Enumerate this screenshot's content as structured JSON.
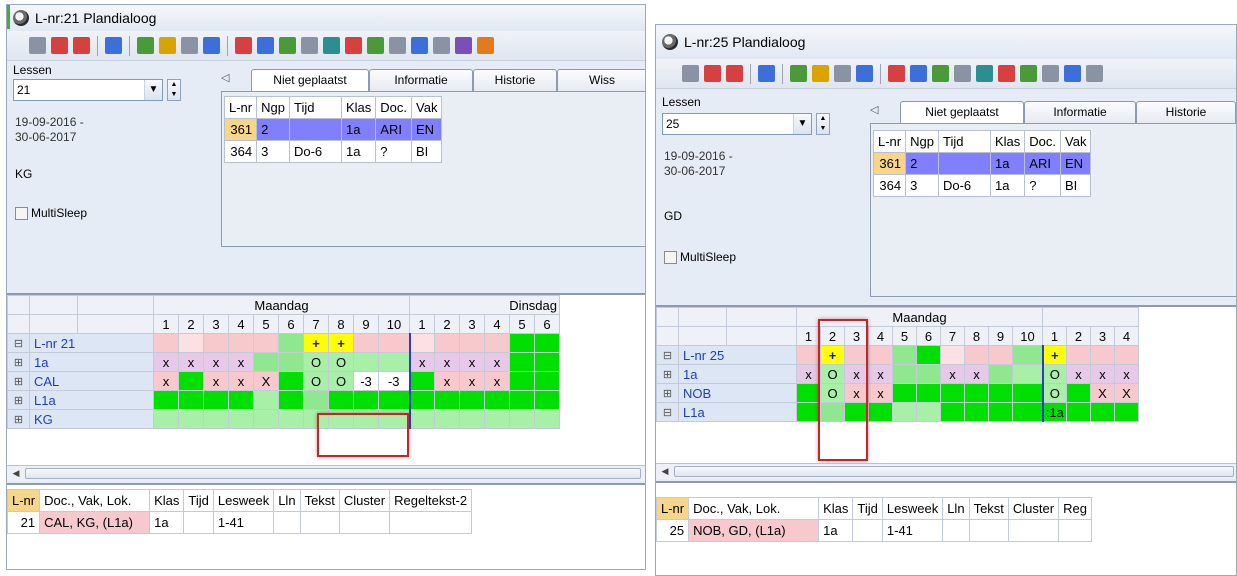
{
  "win1": {
    "title": "L-nr:21  Plandialoog",
    "lessons_label": "Lessen",
    "lesson_value": "21",
    "date_from": "19-09-2016 -",
    "date_to": "30-06-2017",
    "user_code": "KG",
    "multisleep": "MultiSleep",
    "tabs": [
      "Niet geplaatst",
      "Informatie",
      "Historie",
      "Wiss"
    ],
    "np_headers": [
      "L-nr",
      "Ngp",
      "Tijd",
      "Klas",
      "Doc.",
      "Vak"
    ],
    "np_rows": [
      [
        "361",
        "2",
        "",
        "1a",
        "ARI",
        "EN"
      ],
      [
        "364",
        "3",
        "Do-6",
        "1a",
        "?",
        "BI"
      ]
    ],
    "day1": "Maandag",
    "day2": "Dinsdag",
    "periods": [
      "1",
      "2",
      "3",
      "4",
      "5",
      "6",
      "7",
      "8",
      "9",
      "10",
      "1",
      "2",
      "3",
      "4",
      "5",
      "6"
    ],
    "rows": [
      {
        "exp": "⊟",
        "label": "L-nr 21",
        "cells": [
          "",
          "",
          "",
          "",
          "",
          "",
          "+",
          "+",
          "",
          "",
          "",
          "",
          "",
          "",
          "",
          ""
        ]
      },
      {
        "exp": "⊞",
        "label": "1a",
        "cells": [
          "x",
          "x",
          "x",
          "x",
          "",
          "",
          "O",
          "O",
          "",
          "",
          "x",
          "x",
          "x",
          "x",
          "",
          ""
        ]
      },
      {
        "exp": "⊞",
        "label": "CAL",
        "cells": [
          "x",
          "",
          "x",
          "x",
          "X",
          "",
          "O",
          "O",
          "-3",
          "-3",
          "",
          "x",
          "x",
          "x",
          "",
          ""
        ]
      },
      {
        "exp": "⊞",
        "label": "L1a",
        "cells": [
          "",
          "",
          "",
          "",
          "",
          "",
          "",
          "",
          "",
          "",
          "",
          "",
          "",
          "",
          "",
          ""
        ]
      },
      {
        "exp": "⊞",
        "label": "KG",
        "cells": [
          "",
          "",
          "",
          "",
          "",
          "",
          "",
          "",
          "",
          "",
          "",
          "",
          "",
          "",
          "",
          ""
        ]
      }
    ],
    "bottom_headers": [
      "L-nr",
      "Doc., Vak, Lok.",
      "Klas",
      "Tijd",
      "Lesweek",
      "Lln",
      "Tekst",
      "Cluster",
      "Regeltekst-2"
    ],
    "bottom_row": [
      "21",
      "CAL, KG, (L1a)",
      "1a",
      "",
      "1-41",
      "",
      "",
      "",
      ""
    ]
  },
  "win2": {
    "title": "L-nr:25  Plandialoog",
    "lessons_label": "Lessen",
    "lesson_value": "25",
    "date_from": "19-09-2016 -",
    "date_to": "30-06-2017",
    "user_code": "GD",
    "multisleep": "MultiSleep",
    "tabs": [
      "Niet geplaatst",
      "Informatie",
      "Historie"
    ],
    "np_headers": [
      "L-nr",
      "Ngp",
      "Tijd",
      "Klas",
      "Doc.",
      "Vak"
    ],
    "np_rows": [
      [
        "361",
        "2",
        "",
        "1a",
        "ARI",
        "EN"
      ],
      [
        "364",
        "3",
        "Do-6",
        "1a",
        "?",
        "BI"
      ]
    ],
    "day1": "Maandag",
    "periods": [
      "1",
      "2",
      "3",
      "4",
      "5",
      "6",
      "7",
      "8",
      "9",
      "10",
      "1",
      "2",
      "3",
      "4"
    ],
    "rows": [
      {
        "exp": "⊟",
        "label": "L-nr 25",
        "cells": [
          "",
          "+",
          "",
          "",
          "",
          "",
          "",
          "",
          "",
          "",
          "+",
          "",
          "",
          ""
        ]
      },
      {
        "exp": "⊞",
        "label": "1a",
        "cells": [
          "x",
          "O",
          "x",
          "x",
          "",
          "",
          "x",
          "x",
          "",
          "",
          "O",
          "x",
          "x",
          "x"
        ]
      },
      {
        "exp": "⊞",
        "label": "NOB",
        "cells": [
          "",
          "O",
          "x",
          "x",
          "",
          "",
          "",
          "",
          "",
          "",
          "O",
          "",
          "X",
          "X"
        ]
      },
      {
        "exp": "⊟",
        "label": "L1a",
        "cells": [
          "",
          "",
          "",
          "",
          "",
          "",
          "",
          "",
          "",
          "",
          ":1a",
          "",
          "",
          ""
        ]
      }
    ],
    "bottom_headers": [
      "L-nr",
      "Doc., Vak, Lok.",
      "Klas",
      "Tijd",
      "Lesweek",
      "Lln",
      "Tekst",
      "Cluster",
      "Reg"
    ],
    "bottom_row": [
      "25",
      "NOB, GD, (L1a)",
      "1a",
      "",
      "1-41",
      "",
      "",
      "",
      ""
    ]
  },
  "colors": {
    "pink": "#f8c9cc",
    "light_pink": "#fde0e2",
    "green": "#00e000",
    "pale_green": "#a8f0a8",
    "mid_green": "#8fe88f",
    "purple_row": "#e8c8e8",
    "selected_row": "#8080ff",
    "highlight_yellow": "#ffff00"
  }
}
